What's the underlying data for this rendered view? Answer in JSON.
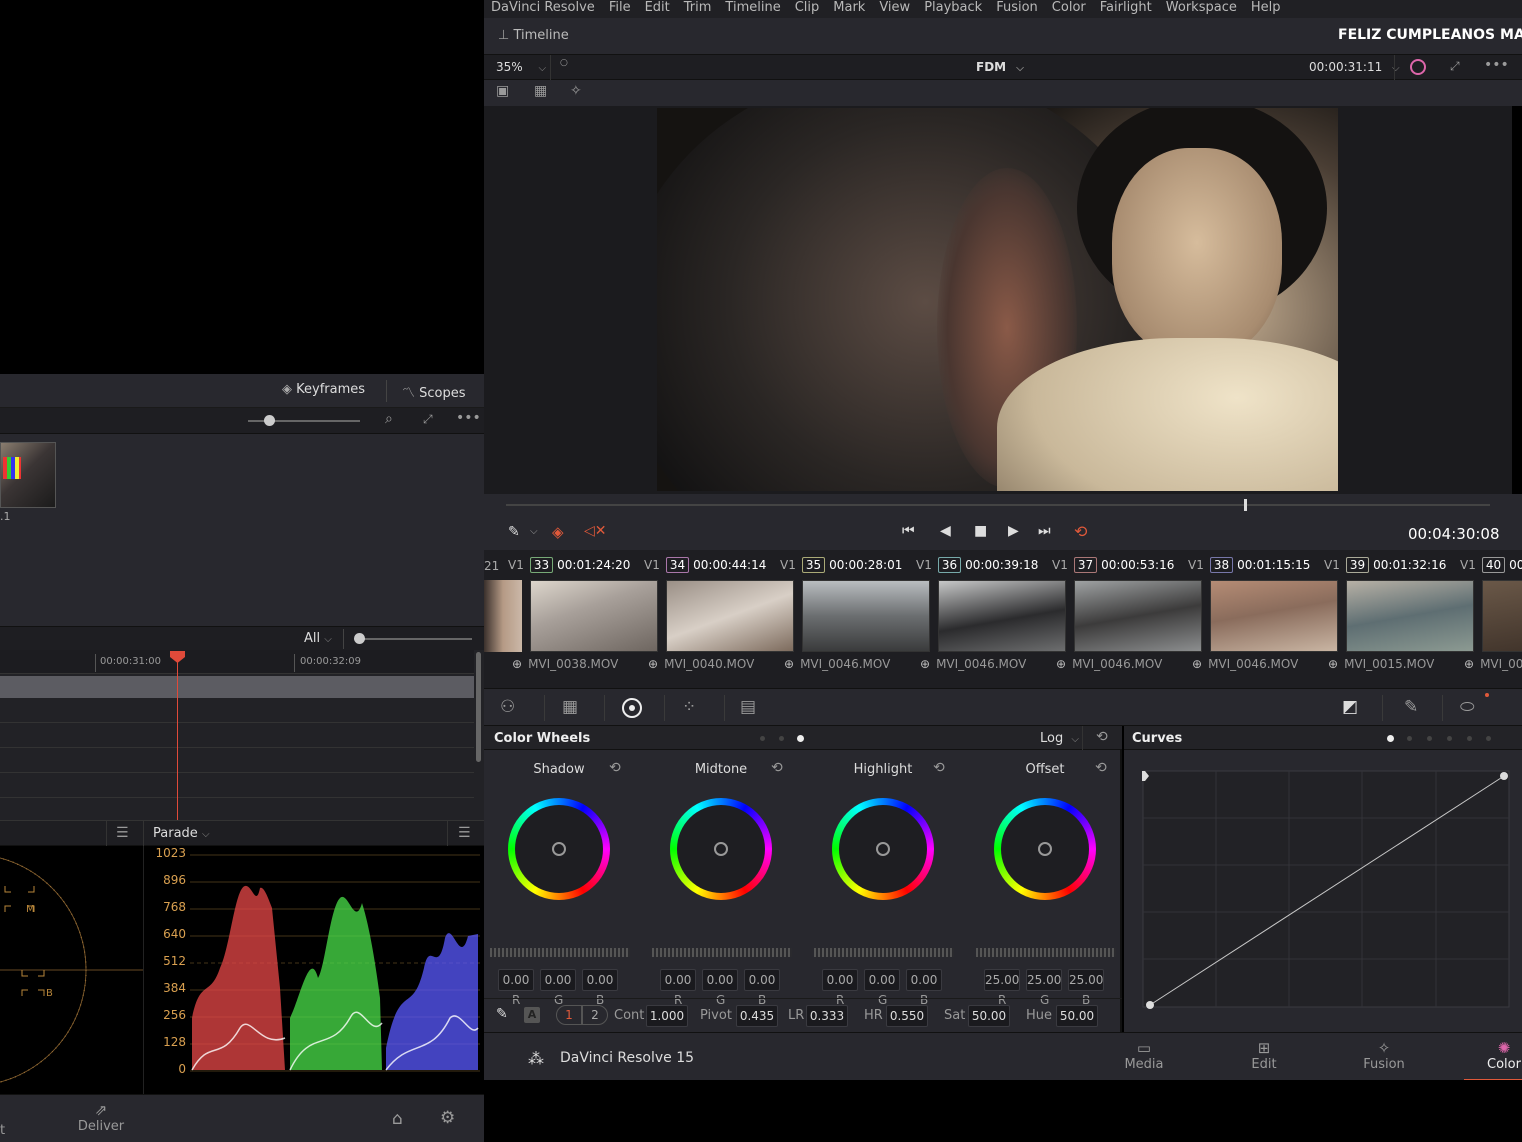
{
  "menu": [
    "DaVinci Resolve",
    "File",
    "Edit",
    "Trim",
    "Timeline",
    "Clip",
    "Mark",
    "View",
    "Playback",
    "Fusion",
    "Color",
    "Fairlight",
    "Workspace",
    "Help"
  ],
  "header": {
    "timeline_label": "Timeline",
    "project_title": "FELIZ CUMPLEANOS MAM"
  },
  "viewer": {
    "zoom": "35%",
    "timeline_name": "FDM",
    "timecode_top": "00:00:31:11",
    "timecode_playhead": "00:04:30:08"
  },
  "left": {
    "keyframes_label": "Keyframes",
    "scopes_label": "Scopes",
    "clip_label_partial": ".1",
    "filter_all": "All",
    "ruler": [
      "00:00:31:00",
      "00:00:32:09"
    ],
    "parade_label": "Parade",
    "parade_ticks": [
      "1023",
      "896",
      "768",
      "640",
      "512",
      "384",
      "256",
      "128",
      "0"
    ],
    "vector_marks": [
      "M",
      "B"
    ],
    "deliver_label": "Deliver",
    "cut_partial": "t"
  },
  "clips": [
    {
      "track": "V1",
      "num": "33",
      "tc": "00:01:24:20",
      "name": "MVI_0038.MOV"
    },
    {
      "track": "V1",
      "num": "34",
      "tc": "00:00:44:14",
      "name": "MVI_0040.MOV"
    },
    {
      "track": "V1",
      "num": "35",
      "tc": "00:00:28:01",
      "name": "MVI_0046.MOV"
    },
    {
      "track": "V1",
      "num": "36",
      "tc": "00:00:39:18",
      "name": "MVI_0046.MOV"
    },
    {
      "track": "V1",
      "num": "37",
      "tc": "00:00:53:16",
      "name": "MVI_0046.MOV"
    },
    {
      "track": "V1",
      "num": "38",
      "tc": "00:01:15:15",
      "name": "MVI_0046.MOV"
    },
    {
      "track": "V1",
      "num": "39",
      "tc": "00:01:32:16",
      "name": "MVI_0015.MOV"
    },
    {
      "track": "V1",
      "num": "40",
      "tc": "00",
      "name": "MVI_00"
    }
  ],
  "clip_partial_left": "21",
  "color_wheels": {
    "title": "Color Wheels",
    "mode": "Log",
    "wheels": [
      {
        "name": "Shadow",
        "r": "0.00",
        "g": "0.00",
        "b": "0.00"
      },
      {
        "name": "Midtone",
        "r": "0.00",
        "g": "0.00",
        "b": "0.00"
      },
      {
        "name": "Highlight",
        "r": "0.00",
        "g": "0.00",
        "b": "0.00"
      },
      {
        "name": "Offset",
        "r": "25.00",
        "g": "25.00",
        "b": "25.00"
      }
    ],
    "rgb_labels": [
      "R",
      "G",
      "B"
    ],
    "page1": "1",
    "page2": "2",
    "auto": "A",
    "params": [
      {
        "label": "Cont",
        "value": "1.000"
      },
      {
        "label": "Pivot",
        "value": "0.435"
      },
      {
        "label": "LR",
        "value": "0.333"
      },
      {
        "label": "HR",
        "value": "0.550"
      },
      {
        "label": "Sat",
        "value": "50.00"
      },
      {
        "label": "Hue",
        "value": "50.00"
      }
    ]
  },
  "curves": {
    "title": "Curves"
  },
  "footer": {
    "app_name": "DaVinci Resolve 15",
    "pages": [
      "Media",
      "Edit",
      "Fusion",
      "Color"
    ]
  }
}
